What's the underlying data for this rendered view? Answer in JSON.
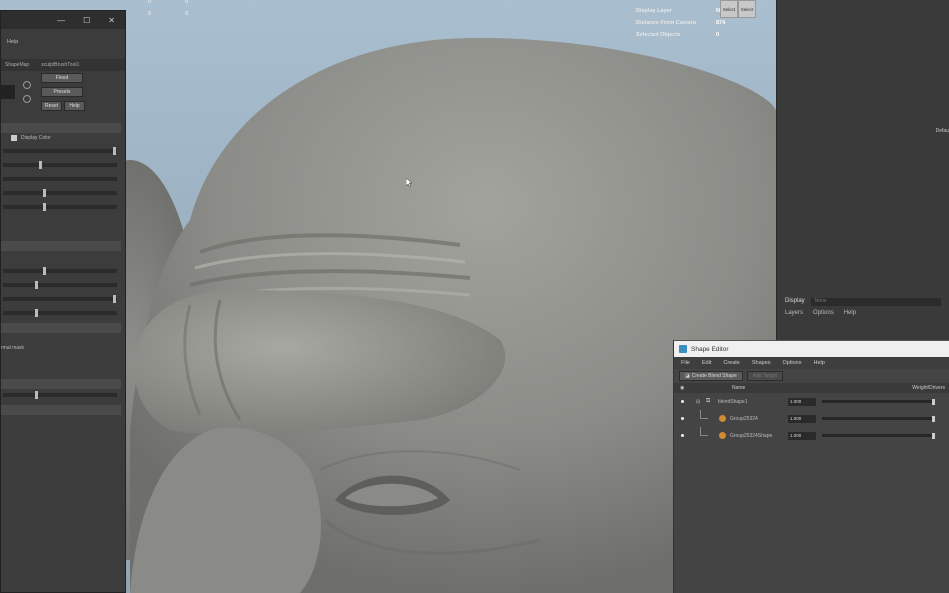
{
  "viewport": {
    "hud_cols": [
      "0",
      "0",
      "0",
      "0"
    ],
    "hud_right": [
      {
        "key": "Display Layer",
        "value": "No"
      },
      {
        "key": "Distance From Camera",
        "value": "874"
      },
      {
        "key": "Selected Objects",
        "value": "0"
      }
    ],
    "hud_buttons": [
      "Select",
      "Select"
    ]
  },
  "right_panel": {
    "display_label": "Display",
    "display_field": "None",
    "menu": [
      "Layers",
      "Options",
      "Help"
    ],
    "edge_label": "Defau"
  },
  "tool_panel": {
    "help": "Help",
    "tabs": [
      "ShapeMap",
      "sculptBrushTool1"
    ],
    "buttons": {
      "flood": "Flood",
      "presets": "Presets",
      "reset": "Reset",
      "help": "Help"
    },
    "display_color_label": "Display Color",
    "normals_label": "rmal mask"
  },
  "shape_editor": {
    "title": "Shape Editor",
    "menu": [
      "File",
      "Edit",
      "Create",
      "Shapes",
      "Options",
      "Help"
    ],
    "toolbar": {
      "create_blend": "Create Blend Shape",
      "add_target": "Add Target"
    },
    "columns": {
      "name": "Name",
      "weight": "Weight/Drivers"
    },
    "rows": [
      {
        "name": "blendShape1",
        "value": "1.000"
      },
      {
        "name": "Group25324",
        "value": "1.000"
      },
      {
        "name": "Group25324Shape",
        "value": "1.000"
      }
    ]
  }
}
